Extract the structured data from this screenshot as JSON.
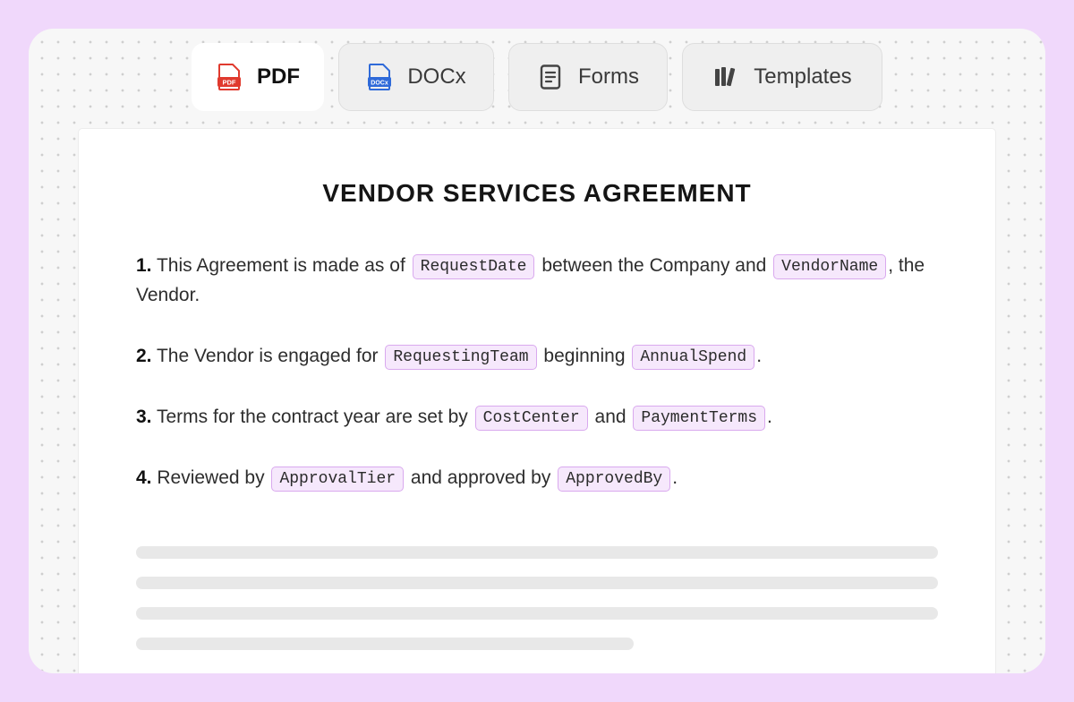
{
  "tabs": {
    "pdf": {
      "label": "PDF",
      "icon_text": "PDF",
      "color": "#e03a2e"
    },
    "docx": {
      "label": "DOCx",
      "icon_text": "DOCx",
      "color": "#2f6ad9"
    },
    "forms": {
      "label": "Forms"
    },
    "templates": {
      "label": "Templates"
    }
  },
  "document": {
    "title": "VENDOR SERVICES AGREEMENT",
    "clauses": [
      {
        "num": "1.",
        "t1": "This Agreement is made as of",
        "tok1": "RequestDate",
        "t2": "between the Company and",
        "tok2": "VendorName",
        "t3": ", the Vendor."
      },
      {
        "num": "2.",
        "t1": "The Vendor is engaged for",
        "tok1": "RequestingTeam",
        "t2": "beginning",
        "tok2": "AnnualSpend",
        "t3": "."
      },
      {
        "num": "3.",
        "t1": "Terms for the contract year are set by",
        "tok1": "CostCenter",
        "t2": "and",
        "tok2": "PaymentTerms",
        "t3": "."
      },
      {
        "num": "4.",
        "t1": "Reviewed by",
        "tok1": "ApprovalTier",
        "t2": "and approved by",
        "tok2": "ApprovedBy",
        "t3": "."
      }
    ]
  },
  "colors": {
    "accent": "#d9a9ee",
    "token_bg": "#f6e8fc",
    "frame": "#f0d8fb"
  }
}
